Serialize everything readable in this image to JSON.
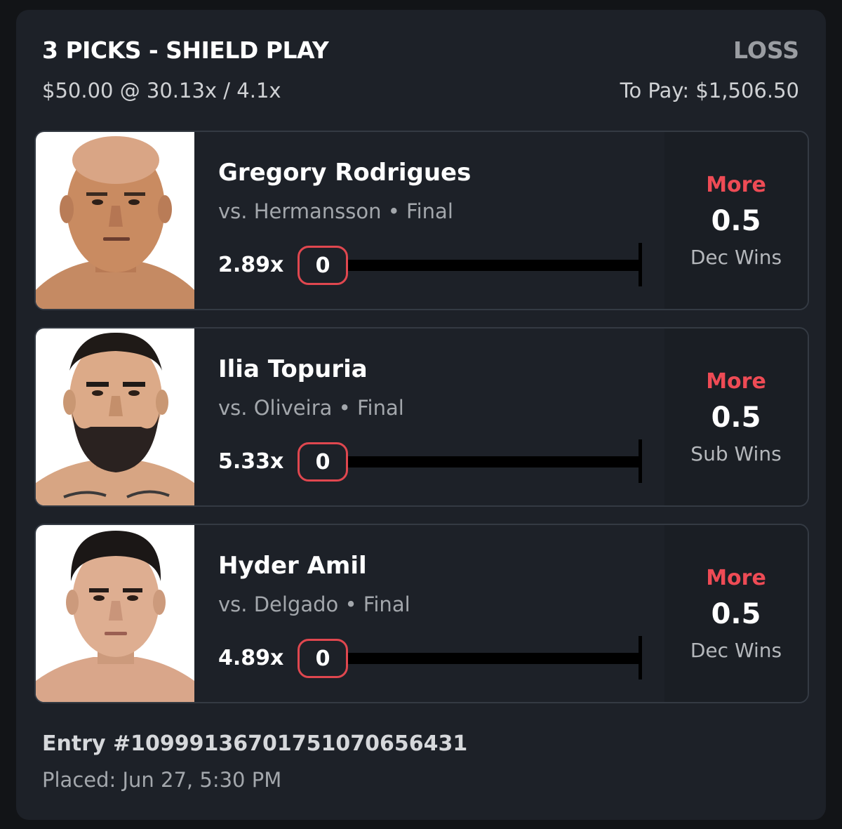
{
  "header": {
    "title": "3 PICKS - SHIELD PLAY",
    "result": "LOSS",
    "stake_line": "$50.00 @ 30.13x / 4.1x",
    "to_pay": "To Pay: $1,506.50"
  },
  "picks": [
    {
      "name": "Gregory Rodrigues",
      "matchup": "vs. Hermansson • Final",
      "multiplier": "2.89x",
      "current": "0",
      "progress_fraction": 0,
      "direction": "More",
      "line": "0.5",
      "stat": "Dec Wins"
    },
    {
      "name": "Ilia Topuria",
      "matchup": "vs. Oliveira • Final",
      "multiplier": "5.33x",
      "current": "0",
      "progress_fraction": 0,
      "direction": "More",
      "line": "0.5",
      "stat": "Sub Wins"
    },
    {
      "name": "Hyder Amil",
      "matchup": "vs. Delgado • Final",
      "multiplier": "4.89x",
      "current": "0",
      "progress_fraction": 0,
      "direction": "More",
      "line": "0.5",
      "stat": "Dec Wins"
    }
  ],
  "footer": {
    "entry": "Entry #1099913670175107065643​1",
    "placed": "Placed: Jun 27, 5:30 PM"
  },
  "colors": {
    "background": "#121417",
    "card": "#1d2128",
    "accent_red": "#ee4b55",
    "loss_gray": "#9a9da2"
  }
}
